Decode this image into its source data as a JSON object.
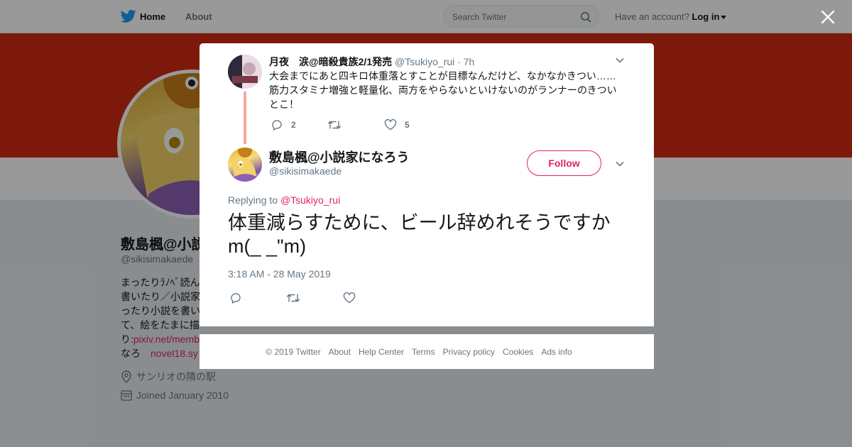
{
  "topnav": {
    "home_label": "Home",
    "about_label": "About",
    "search_placeholder": "Search Twitter",
    "account_text": "Have an account?",
    "login_label": "Log in"
  },
  "profile": {
    "name": "敷島楓@小説家になろう",
    "name_visible": "敷島楓@小説",
    "handle": "@sikisimakaede",
    "bio_lines": [
      "まったりﾗﾉﾍﾞ読ん",
      "書いたり／小説家",
      "ったり小説を書い",
      "て、絵をたまに描",
      "り:"
    ],
    "bio_link1": "pixiv.net/memb",
    "bio_line6": "なろ",
    "bio_link2": "novel18.sy",
    "location": "サンリオの隣の駅",
    "joined": "Joined January 2010"
  },
  "parent_tweet": {
    "author_name": "月夜　涙@暗殺貴族2/1発売",
    "author_handle": "@Tsukiyo_rui",
    "time": "· 7h",
    "text_line1": "大会までにあと四キロ体重落とすことが目標なんだけど、なかなかきつい……",
    "text_line2": "筋力スタミナ増強と軽量化、両方をやらないといけないのがランナーのきつい",
    "text_line3": "とこ！",
    "reply_count": "2",
    "retweet_count": "",
    "like_count": "5"
  },
  "main_tweet": {
    "author_name": "敷島楓@小説家になろう",
    "author_handle": "@sikisimakaede",
    "follow_label": "Follow",
    "replying_prefix": "Replying to",
    "replying_to": "@Tsukiyo_rui",
    "text_line1": "体重減らすために、ビール辞めれそうですか",
    "text_line2": "m(_ _\"m)",
    "timestamp": "3:18 AM - 28 May 2019"
  },
  "footer": {
    "links": [
      "© 2019 Twitter",
      "About",
      "Help Center",
      "Terms",
      "Privacy policy",
      "Cookies",
      "Ads info"
    ]
  },
  "colors": {
    "accent": "#e0245e",
    "banner": "#d12a12",
    "thread_line": "#f5a9a0",
    "brand": "#1da1f2"
  }
}
